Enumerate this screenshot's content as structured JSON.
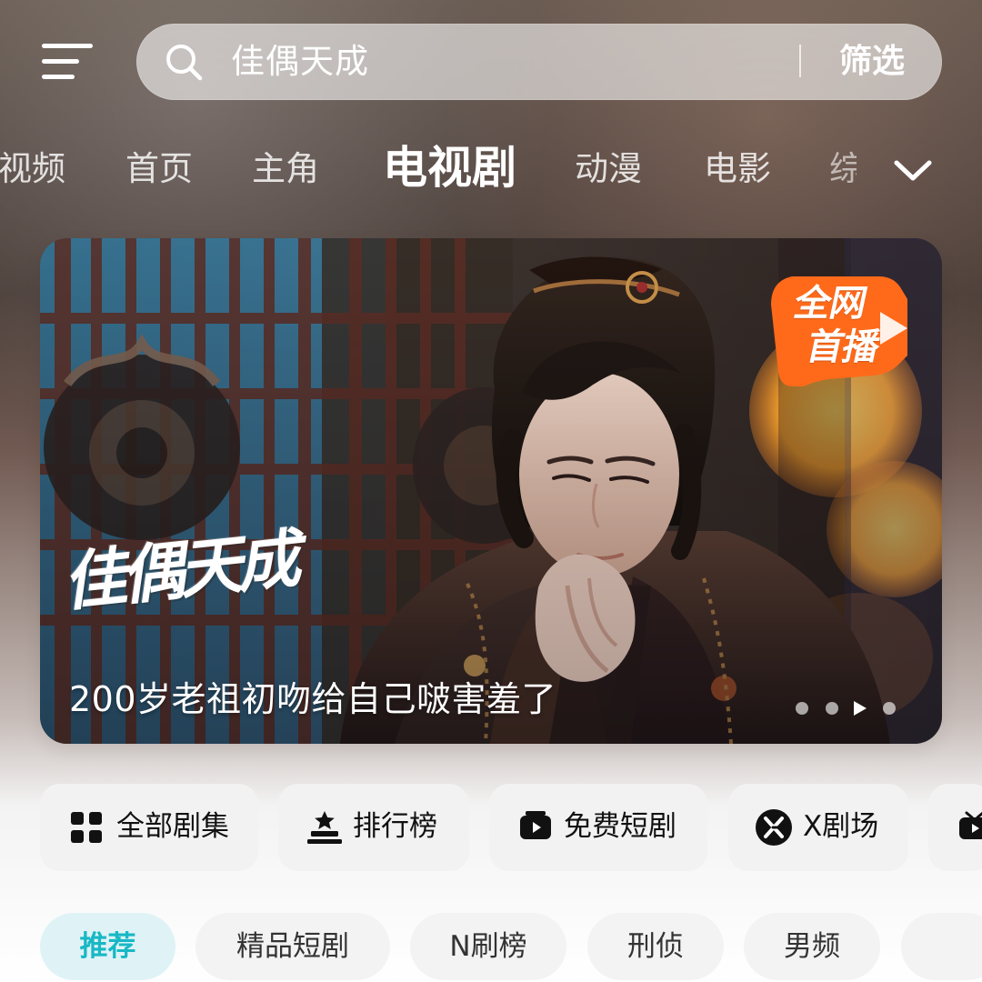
{
  "header": {
    "search_placeholder": "佳偶天成",
    "filter_label": "筛选"
  },
  "tabs": [
    {
      "label": "视频"
    },
    {
      "label": "首页"
    },
    {
      "label": "主角"
    },
    {
      "label": "电视剧",
      "active": true
    },
    {
      "label": "动漫"
    },
    {
      "label": "电影"
    },
    {
      "label": "综"
    }
  ],
  "banner": {
    "show_title": "佳偶天成",
    "caption": "200岁老祖初吻给自己啵害羞了",
    "badge": [
      "全网",
      "首播"
    ]
  },
  "quick_actions": [
    {
      "label": "全部剧集",
      "icon": "grid-icon"
    },
    {
      "label": "排行榜",
      "icon": "ranking-icon"
    },
    {
      "label": "免费短剧",
      "icon": "tv-play-icon"
    },
    {
      "label": "X剧场",
      "icon": "x-theater-icon"
    },
    {
      "label": "",
      "icon": "tv-icon"
    }
  ],
  "subtabs": [
    {
      "label": "推荐",
      "active": true
    },
    {
      "label": "精品短剧"
    },
    {
      "label": "N刷榜"
    },
    {
      "label": "刑侦"
    },
    {
      "label": "男频"
    },
    {
      "label": ""
    }
  ],
  "colors": {
    "accent": "#18b8c5",
    "badge_orange": "#ff6a1a"
  }
}
